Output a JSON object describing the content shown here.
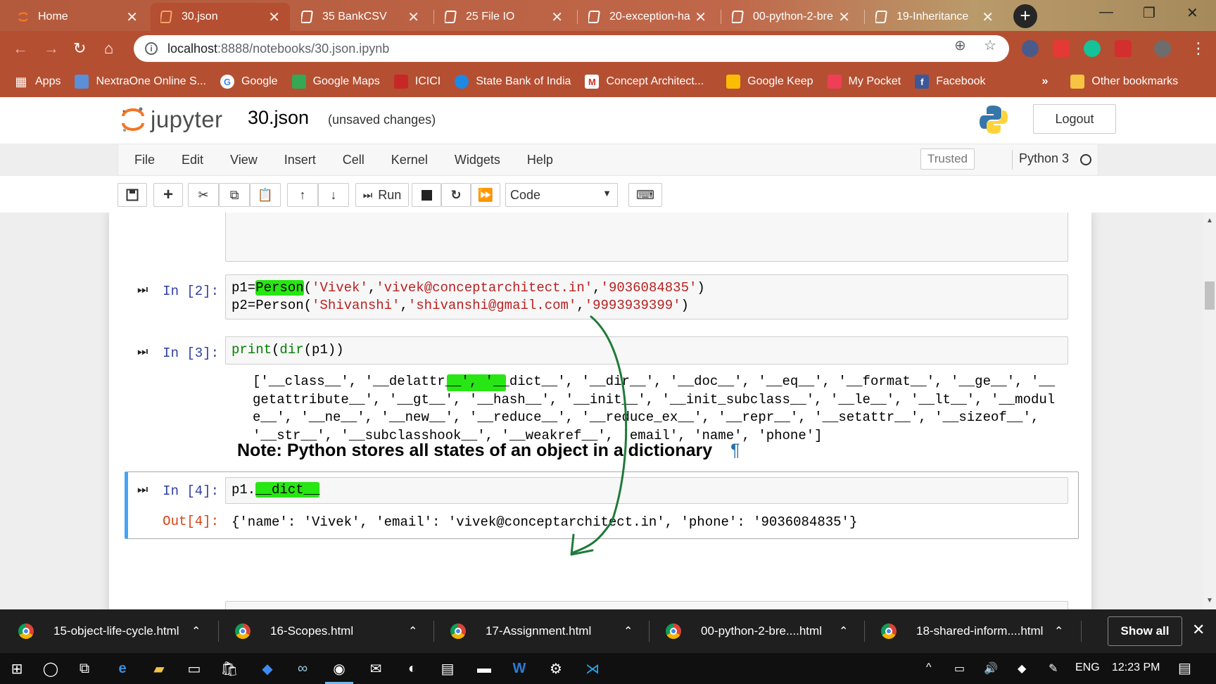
{
  "browser": {
    "tabs": [
      {
        "title": "Home",
        "icon": "jupyter-icon"
      },
      {
        "title": "30.json",
        "icon": "jupyter-notebook-icon",
        "active": true
      },
      {
        "title": "35 BankCSV",
        "icon": "jupyter-notebook-icon"
      },
      {
        "title": "25 File IO",
        "icon": "jupyter-notebook-icon"
      },
      {
        "title": "20-exception-ha",
        "icon": "jupyter-notebook-icon"
      },
      {
        "title": "00-python-2-bre",
        "icon": "jupyter-notebook-icon"
      },
      {
        "title": "19-Inheritance",
        "icon": "jupyter-notebook-icon"
      }
    ],
    "url": {
      "host": "localhost",
      "path": ":8888/notebooks/30.json.ipynb"
    },
    "bookmarks": [
      {
        "label": "Apps",
        "color": "#4285f4"
      },
      {
        "label": "NextraOne Online S...",
        "color": "#5b8fd6"
      },
      {
        "label": "Google",
        "color": "#ea4335"
      },
      {
        "label": "Google Maps",
        "color": "#34a853"
      },
      {
        "label": "ICICI",
        "color": "#c62828"
      },
      {
        "label": "State Bank of India",
        "color": "#1e88e5"
      },
      {
        "label": "Concept Architect...",
        "color": "#d93025"
      },
      {
        "label": "Google Keep",
        "color": "#fbbc04"
      },
      {
        "label": "My Pocket",
        "color": "#ef3f56"
      },
      {
        "label": "Facebook",
        "color": "#3b5998"
      }
    ],
    "bookmarks_overflow": "»",
    "other_bookmarks": "Other bookmarks"
  },
  "jupyter": {
    "logo_text": "jupyter",
    "notebook_name": "30.json",
    "save_status": "(unsaved changes)",
    "logout": "Logout",
    "menu": [
      "File",
      "Edit",
      "View",
      "Insert",
      "Cell",
      "Kernel",
      "Widgets",
      "Help"
    ],
    "trusted": "Trusted",
    "kernel": "Python 3",
    "run_label": "Run",
    "cell_type": "Code"
  },
  "cells": {
    "c2": {
      "prompt": "In [2]:"
    },
    "c3": {
      "prompt": "In [3]:",
      "code": "print(dir(p1))"
    },
    "c3_output": [
      "['__class__', '__delattr__', '__dict__', '__dir__', '__doc__', '__eq__', '__format__', '__ge__', '__",
      "getattribute__', '__gt__', '__hash__', '__init__', '__init_subclass__', '__le__', '__lt__', '__modul",
      "e__', '__ne__', '__new__', '__reduce__', '__reduce_ex__', '__repr__', '__setattr__', '__sizeof__',",
      "'__str__', '__subclasshook__', '__weakref__', 'email', 'name', 'phone']"
    ],
    "markdown": {
      "heading": "Note: Python stores all states of an object in a dictionary",
      "anchor": "¶"
    },
    "c4": {
      "prompt": "In [4]:",
      "out_prompt": "Out[4]:",
      "output": "{'name': 'Vivek', 'email': 'vivek@conceptarchitect.in', 'phone': '9036084835'}"
    }
  },
  "downloads": [
    {
      "file": "15-object-life-cycle.html"
    },
    {
      "file": "16-Scopes.html"
    },
    {
      "file": "17-Assignment.html"
    },
    {
      "file": "00-python-2-bre....html"
    },
    {
      "file": "18-shared-inform....html"
    }
  ],
  "show_all": "Show all",
  "taskbar": {
    "lang": "ENG",
    "time": "12:23 PM"
  },
  "colors": {
    "browser_accent": "#b54f31",
    "highlight": "#28e614",
    "arrow": "#1f7a3a",
    "selected_cell": "#42a5f5"
  }
}
